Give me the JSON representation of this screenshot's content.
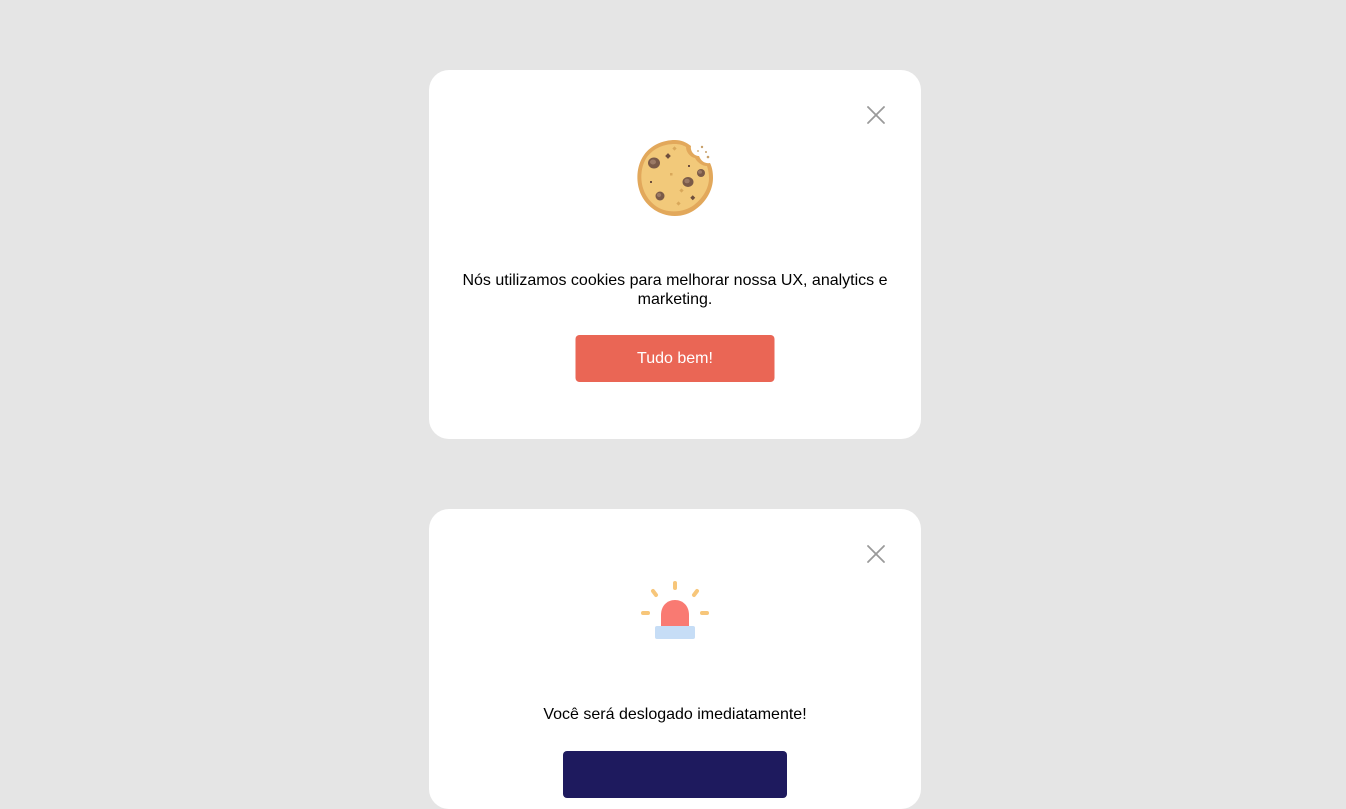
{
  "cookie_modal": {
    "message": "Nós utilizamos cookies para melhorar nossa UX, analytics e marketing.",
    "button_label": "Tudo bem!",
    "button_color": "#ea6655",
    "icon": "cookie-icon",
    "close_icon": "close-icon"
  },
  "logout_modal": {
    "message": "Você será deslogado imediatamente!",
    "button_label": "",
    "button_color": "#1e1a5e",
    "icon": "siren-icon",
    "close_icon": "close-icon"
  },
  "colors": {
    "background": "#e5e5e5",
    "card": "#ffffff"
  }
}
